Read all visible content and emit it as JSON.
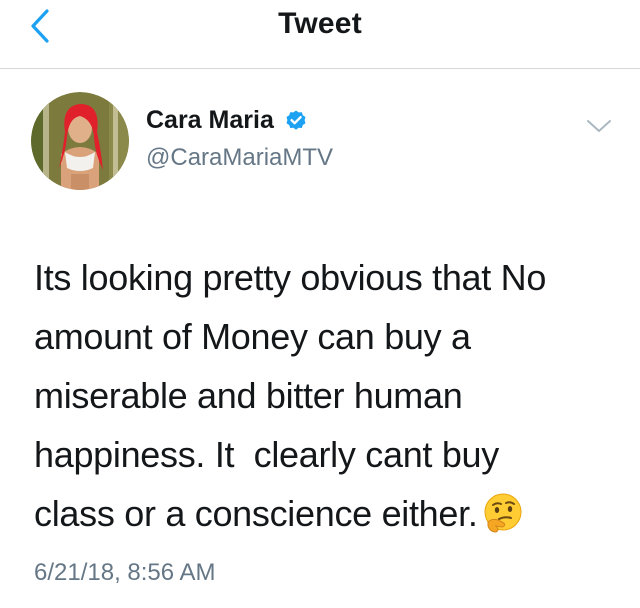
{
  "header": {
    "title": "Tweet",
    "back_icon": "chevron-left-icon",
    "accent_color": "#1da1f2"
  },
  "tweet": {
    "author": {
      "display_name": "Cara Maria",
      "handle": "@CaraMariaMTV",
      "verified": true,
      "verified_icon": "verified-badge-icon"
    },
    "text_lines": [
      "Its looking pretty obvious that No",
      "amount of Money can buy a",
      "miserable and bitter human",
      "happiness. It  clearly cant buy",
      "class or a conscience either."
    ],
    "emoji": "thinking-face-emoji",
    "timestamp": "6/21/18, 8:56 AM",
    "menu_icon": "chevron-down-icon"
  }
}
